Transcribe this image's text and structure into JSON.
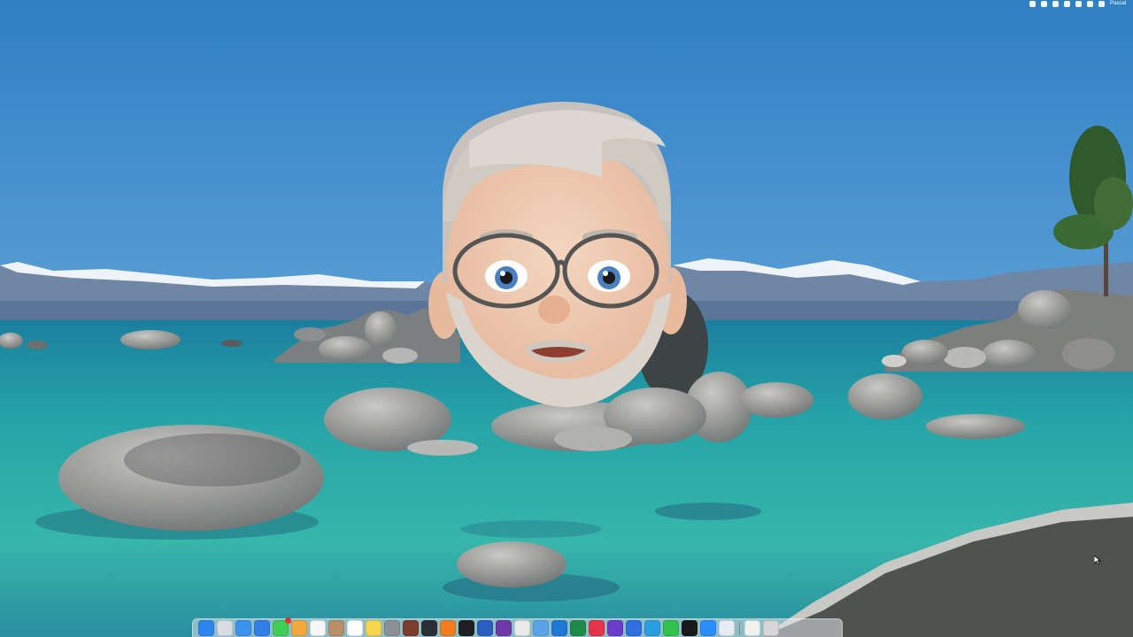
{
  "menubar": {
    "status_icons": [
      "control-center-icon",
      "airplay-icon",
      "wifi-icon",
      "shield-icon",
      "bluetooth-icon",
      "search-icon",
      "siri-icon"
    ],
    "user_name": "Pascal"
  },
  "dock": {
    "items": [
      {
        "name": "finder-icon",
        "color": "#2d86ee"
      },
      {
        "name": "launchpad-icon",
        "color": "#d9dde3"
      },
      {
        "name": "mail-icon",
        "color": "#3b92f0"
      },
      {
        "name": "safari-icon",
        "color": "#2f7fe6"
      },
      {
        "name": "messages-icon",
        "color": "#3fcf58",
        "badge": true
      },
      {
        "name": "photos-icon",
        "color": "#f2a83a"
      },
      {
        "name": "calendar-icon",
        "color": "#f6f6f6"
      },
      {
        "name": "contacts-icon",
        "color": "#b7906a"
      },
      {
        "name": "reminders-icon",
        "color": "#ffffff"
      },
      {
        "name": "notes-icon",
        "color": "#f7d64a"
      },
      {
        "name": "settings-icon",
        "color": "#8d8f94"
      },
      {
        "name": "dictionary-icon",
        "color": "#7a3c2b"
      },
      {
        "name": "app-store-icon",
        "color": "#2d2f36"
      },
      {
        "name": "books-icon",
        "color": "#f27c1f"
      },
      {
        "name": "terminal-icon",
        "color": "#1f1f22"
      },
      {
        "name": "word-icon",
        "color": "#2b5fbf"
      },
      {
        "name": "onenote-icon",
        "color": "#6f3aa8"
      },
      {
        "name": "chrome-icon",
        "color": "#e9e9e9"
      },
      {
        "name": "finder-alt-icon",
        "color": "#5aa3e8"
      },
      {
        "name": "outlook-icon",
        "color": "#1f78d4"
      },
      {
        "name": "excel-icon",
        "color": "#1e8a4a"
      },
      {
        "name": "music-icon",
        "color": "#e8344a"
      },
      {
        "name": "imovie-icon",
        "color": "#6b3dc9"
      },
      {
        "name": "vpn-icon",
        "color": "#2f6fe0"
      },
      {
        "name": "telegram-icon",
        "color": "#2a9fe0"
      },
      {
        "name": "whatsapp-icon",
        "color": "#31c24e"
      },
      {
        "name": "camera-icon",
        "color": "#1a1a1a"
      },
      {
        "name": "zoom-icon",
        "color": "#2d8cff"
      },
      {
        "name": "browser-icon",
        "color": "#e6ecf3"
      }
    ],
    "trailing": [
      {
        "name": "document-icon",
        "color": "#f1f1f1"
      },
      {
        "name": "trash-icon",
        "color": "#d6d6d8"
      }
    ]
  }
}
